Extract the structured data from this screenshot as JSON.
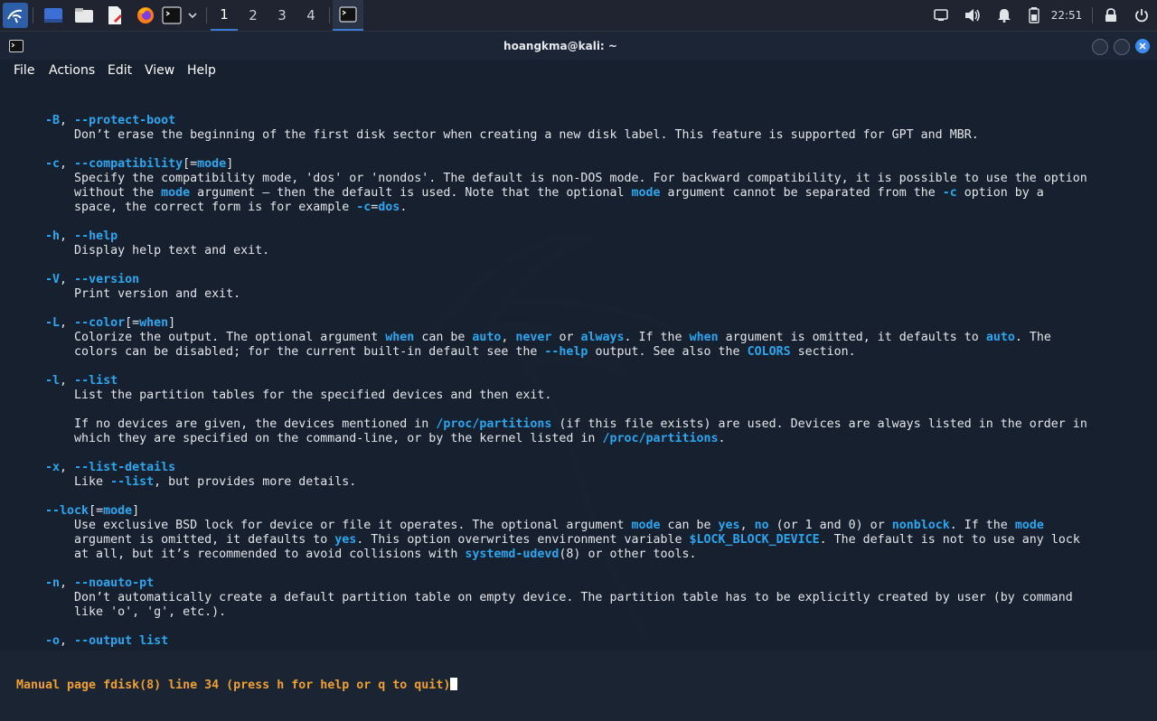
{
  "panel": {
    "workspaces": [
      "1",
      "2",
      "3",
      "4"
    ],
    "active_workspace": "1",
    "clock": "22:51",
    "icons": [
      "kali-menu-icon",
      "desktop-icon",
      "file-manager-icon",
      "text-editor-icon",
      "firefox-icon",
      "terminal-icon",
      "chevron-down-icon",
      "terminal-task-icon",
      "display-icon",
      "volume-icon",
      "notification-bell-icon",
      "battery-icon",
      "lock-icon",
      "power-icon"
    ]
  },
  "window": {
    "title": "hoangkma@kali: ~",
    "menu": [
      "File",
      "Actions",
      "Edit",
      "View",
      "Help"
    ]
  },
  "colors": {
    "bold_option": "#2aa7f0",
    "status_text": "#f0a030",
    "plain_text": "#e4e6ea"
  },
  "man": {
    "status": "Manual page fdisk(8) line 34 (press h for help or q to quit)",
    "lines": [
      [
        [
          "    ",
          "p"
        ],
        [
          "-B",
          "b"
        ],
        [
          ", ",
          "p"
        ],
        [
          "--protect-boot",
          "b"
        ]
      ],
      [
        [
          "        Don’t erase the beginning of the first disk sector when creating a new disk label. This feature is supported for GPT and MBR.",
          "p"
        ]
      ],
      [
        [
          "",
          "p"
        ]
      ],
      [
        [
          "    ",
          "p"
        ],
        [
          "-c",
          "b"
        ],
        [
          ", ",
          "p"
        ],
        [
          "--compatibility",
          "b"
        ],
        [
          "[=",
          "p"
        ],
        [
          "mode",
          "b"
        ],
        [
          "]",
          "p"
        ]
      ],
      [
        [
          "        Specify the compatibility mode, 'dos' or 'nondos'. The default is non-DOS mode. For backward compatibility, it is possible to use the option",
          "p"
        ]
      ],
      [
        [
          "        without the ",
          "p"
        ],
        [
          "mode",
          "b"
        ],
        [
          " argument — then the default is used. Note that the optional ",
          "p"
        ],
        [
          "mode",
          "b"
        ],
        [
          " argument cannot be separated from the ",
          "p"
        ],
        [
          "-c",
          "b"
        ],
        [
          " option by a",
          "p"
        ]
      ],
      [
        [
          "        space, the correct form is for example ",
          "p"
        ],
        [
          "-c",
          "b"
        ],
        [
          "=",
          "p"
        ],
        [
          "dos",
          "b"
        ],
        [
          ".",
          "p"
        ]
      ],
      [
        [
          "",
          "p"
        ]
      ],
      [
        [
          "    ",
          "p"
        ],
        [
          "-h",
          "b"
        ],
        [
          ", ",
          "p"
        ],
        [
          "--help",
          "b"
        ]
      ],
      [
        [
          "        Display help text and exit.",
          "p"
        ]
      ],
      [
        [
          "",
          "p"
        ]
      ],
      [
        [
          "    ",
          "p"
        ],
        [
          "-V",
          "b"
        ],
        [
          ", ",
          "p"
        ],
        [
          "--version",
          "b"
        ]
      ],
      [
        [
          "        Print version and exit.",
          "p"
        ]
      ],
      [
        [
          "",
          "p"
        ]
      ],
      [
        [
          "    ",
          "p"
        ],
        [
          "-L",
          "b"
        ],
        [
          ", ",
          "p"
        ],
        [
          "--color",
          "b"
        ],
        [
          "[=",
          "p"
        ],
        [
          "when",
          "b"
        ],
        [
          "]",
          "p"
        ]
      ],
      [
        [
          "        Colorize the output. The optional argument ",
          "p"
        ],
        [
          "when",
          "b"
        ],
        [
          " can be ",
          "p"
        ],
        [
          "auto",
          "b"
        ],
        [
          ", ",
          "p"
        ],
        [
          "never",
          "b"
        ],
        [
          " or ",
          "p"
        ],
        [
          "always",
          "b"
        ],
        [
          ". If the ",
          "p"
        ],
        [
          "when",
          "b"
        ],
        [
          " argument is omitted, it defaults to ",
          "p"
        ],
        [
          "auto",
          "b"
        ],
        [
          ". The",
          "p"
        ]
      ],
      [
        [
          "        colors can be disabled; for the current built-in default see the ",
          "p"
        ],
        [
          "--help",
          "b"
        ],
        [
          " output. See also the ",
          "p"
        ],
        [
          "COLORS",
          "b"
        ],
        [
          " section.",
          "p"
        ]
      ],
      [
        [
          "",
          "p"
        ]
      ],
      [
        [
          "    ",
          "p"
        ],
        [
          "-l",
          "b"
        ],
        [
          ", ",
          "p"
        ],
        [
          "--list",
          "b"
        ]
      ],
      [
        [
          "        List the partition tables for the specified devices and then exit.",
          "p"
        ]
      ],
      [
        [
          "",
          "p"
        ]
      ],
      [
        [
          "        If no devices are given, the devices mentioned in ",
          "p"
        ],
        [
          "/proc/partitions",
          "b"
        ],
        [
          " (if this file exists) are used. Devices are always listed in the order in",
          "p"
        ]
      ],
      [
        [
          "        which they are specified on the command-line, or by the kernel listed in ",
          "p"
        ],
        [
          "/proc/partitions",
          "b"
        ],
        [
          ".",
          "p"
        ]
      ],
      [
        [
          "",
          "p"
        ]
      ],
      [
        [
          "    ",
          "p"
        ],
        [
          "-x",
          "b"
        ],
        [
          ", ",
          "p"
        ],
        [
          "--list-details",
          "b"
        ]
      ],
      [
        [
          "        Like ",
          "p"
        ],
        [
          "--list",
          "b"
        ],
        [
          ", but provides more details.",
          "p"
        ]
      ],
      [
        [
          "",
          "p"
        ]
      ],
      [
        [
          "    ",
          "p"
        ],
        [
          "--lock",
          "b"
        ],
        [
          "[=",
          "p"
        ],
        [
          "mode",
          "b"
        ],
        [
          "]",
          "p"
        ]
      ],
      [
        [
          "        Use exclusive BSD lock for device or file it operates. The optional argument ",
          "p"
        ],
        [
          "mode",
          "b"
        ],
        [
          " can be ",
          "p"
        ],
        [
          "yes",
          "b"
        ],
        [
          ", ",
          "p"
        ],
        [
          "no",
          "b"
        ],
        [
          " (or 1 and 0) or ",
          "p"
        ],
        [
          "nonblock",
          "b"
        ],
        [
          ". If the ",
          "p"
        ],
        [
          "mode",
          "b"
        ]
      ],
      [
        [
          "        argument is omitted, it defaults to ",
          "p"
        ],
        [
          "yes",
          "b"
        ],
        [
          ". This option overwrites environment variable ",
          "p"
        ],
        [
          "$LOCK_BLOCK_DEVICE",
          "b"
        ],
        [
          ". The default is not to use any lock",
          "p"
        ]
      ],
      [
        [
          "        at all, but it’s recommended to avoid collisions with ",
          "p"
        ],
        [
          "systemd-udevd",
          "b"
        ],
        [
          "(8) or other tools.",
          "p"
        ]
      ],
      [
        [
          "",
          "p"
        ]
      ],
      [
        [
          "    ",
          "p"
        ],
        [
          "-n",
          "b"
        ],
        [
          ", ",
          "p"
        ],
        [
          "--noauto-pt",
          "b"
        ]
      ],
      [
        [
          "        Don’t automatically create a default partition table on empty device. The partition table has to be explicitly created by user (by command",
          "p"
        ]
      ],
      [
        [
          "        like 'o', 'g', etc.).",
          "p"
        ]
      ],
      [
        [
          "",
          "p"
        ]
      ],
      [
        [
          "    ",
          "p"
        ],
        [
          "-o",
          "b"
        ],
        [
          ", ",
          "p"
        ],
        [
          "--output",
          "b"
        ],
        [
          " ",
          "p"
        ],
        [
          "list",
          "b"
        ]
      ]
    ]
  }
}
